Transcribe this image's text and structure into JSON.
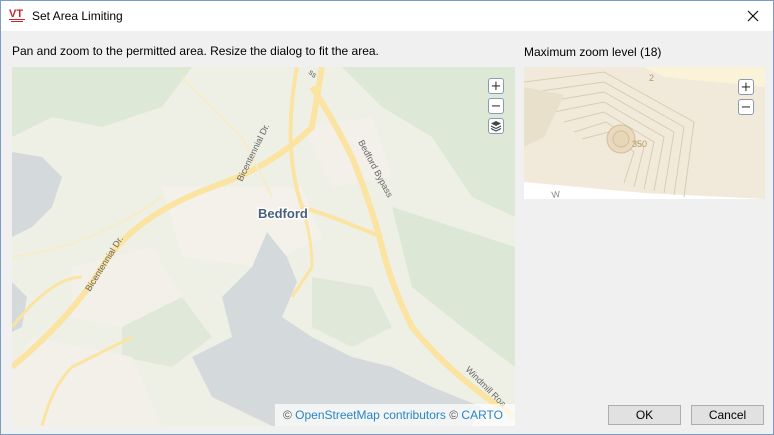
{
  "window": {
    "title": "Set Area Limiting",
    "app_icon_text": "VT"
  },
  "main": {
    "instruction": "Pan and zoom to the permitted area. Resize the dialog to fit the area.",
    "zoom_label": "Maximum zoom level (18)"
  },
  "map": {
    "city_label": "Bedford",
    "road_labels": {
      "bicentennial_upper": "Bicentennial Dr.",
      "bicentennial_lower": "Bicentennial Dr.",
      "bedford_bypass": "Bedford Bypass",
      "windmill": "Windmill Roa",
      "top_cut": "ss"
    },
    "controls": {
      "zoom_in": "+",
      "zoom_out": "−"
    },
    "attribution": {
      "copyright_1": "©",
      "osm_link": "OpenStreetMap contributors",
      "copyright_2": "©",
      "carto_link": "CARTO"
    }
  },
  "zoom_map": {
    "labels": {
      "number_top": "2",
      "number_mid": "350",
      "corner_text": "W"
    },
    "controls": {
      "zoom_in": "+",
      "zoom_out": "−"
    }
  },
  "buttons": {
    "ok": "OK",
    "cancel": "Cancel"
  },
  "colors": {
    "water": "#d4dadc",
    "park": "#dbe7d2",
    "road_major": "#fbe3a2",
    "accent_link": "#2a84c6",
    "city_label": "#4a5f7a",
    "app_icon_red": "#c0282d"
  }
}
